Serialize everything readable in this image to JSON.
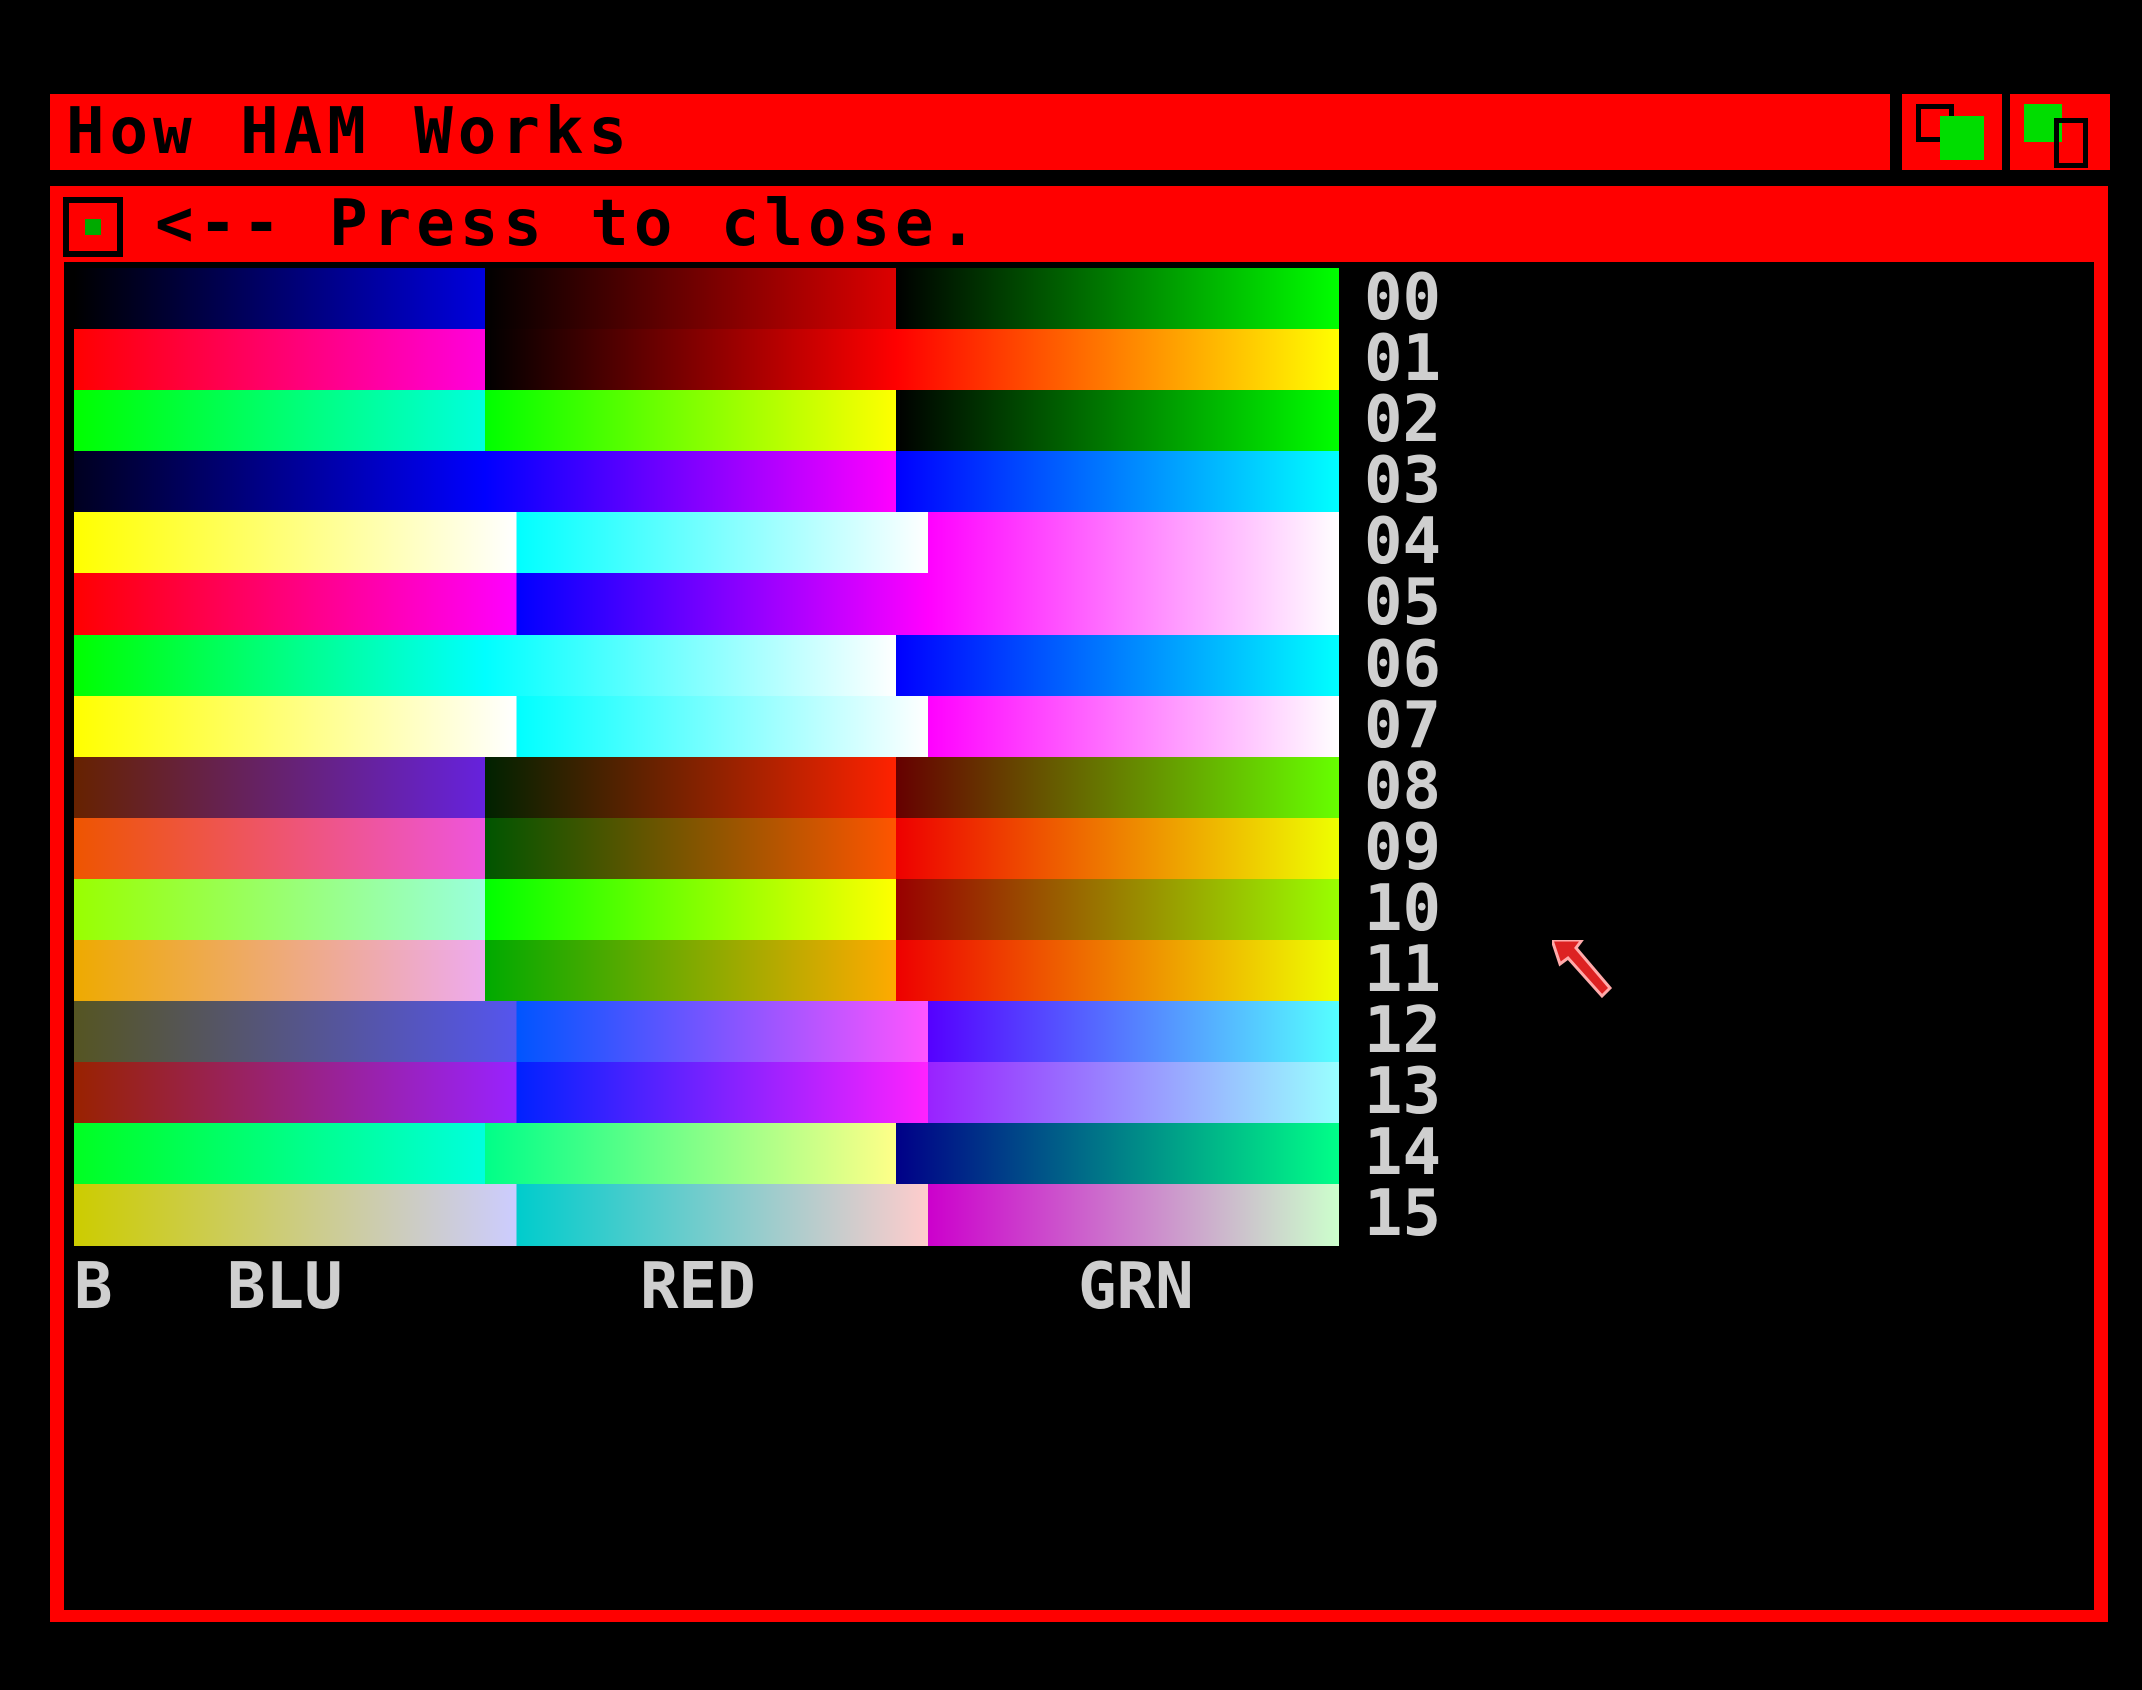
{
  "window": {
    "title": "How HAM Works",
    "close_hint": "<-- Press to close."
  },
  "legend": {
    "b": "B",
    "blu": "BLU",
    "red": "RED",
    "grn": "GRN"
  },
  "rows": [
    {
      "label": "00",
      "bands": [
        {
          "type": "grad",
          "from": "#000000",
          "to": "#0000dd",
          "w": 0.325
        },
        {
          "type": "grad",
          "from": "#000000",
          "to": "#dd0000",
          "w": 0.325
        },
        {
          "type": "grad",
          "from": "#000000",
          "to": "#00ff00",
          "w": 0.35
        }
      ]
    },
    {
      "label": "01",
      "bands": [
        {
          "type": "grad",
          "from": "#ff0000",
          "to": "#ff00dd",
          "w": 0.325
        },
        {
          "type": "grad",
          "from": "#000000",
          "to": "#ff0000",
          "w": 0.325
        },
        {
          "type": "grad",
          "from": "#ff0000",
          "to": "#ffff00",
          "w": 0.35
        }
      ]
    },
    {
      "label": "02",
      "bands": [
        {
          "type": "grad",
          "from": "#00ff00",
          "to": "#00ffdd",
          "w": 0.325
        },
        {
          "type": "grad",
          "from": "#00ff00",
          "to": "#ffff00",
          "w": 0.325
        },
        {
          "type": "grad",
          "from": "#000000",
          "to": "#00ff00",
          "w": 0.35
        }
      ]
    },
    {
      "label": "03",
      "bands": [
        {
          "type": "grad",
          "from": "#000020",
          "to": "#0000ff",
          "w": 0.325
        },
        {
          "type": "grad",
          "from": "#0000ff",
          "to": "#ff00ff",
          "w": 0.325
        },
        {
          "type": "grad",
          "from": "#0000ff",
          "to": "#00ffff",
          "w": 0.35
        }
      ]
    },
    {
      "label": "04",
      "bands": [
        {
          "type": "grad",
          "from": "#ffff00",
          "to": "#ffffff",
          "w": 0.35
        },
        {
          "type": "grad",
          "from": "#00ffff",
          "to": "#ffffff",
          "w": 0.325
        },
        {
          "type": "grad",
          "from": "#ff00ff",
          "to": "#ffffff",
          "w": 0.325
        }
      ]
    },
    {
      "label": "05",
      "bands": [
        {
          "type": "grad",
          "from": "#ff0000",
          "to": "#ff00ff",
          "w": 0.35
        },
        {
          "type": "grad",
          "from": "#0000ff",
          "to": "#ff00ff",
          "w": 0.325
        },
        {
          "type": "grad",
          "from": "#ff00ff",
          "to": "#ffffff",
          "w": 0.325
        }
      ]
    },
    {
      "label": "06",
      "bands": [
        {
          "type": "grad",
          "from": "#00ff00",
          "to": "#00ffff",
          "w": 0.325
        },
        {
          "type": "grad",
          "from": "#00ffff",
          "to": "#ffffff",
          "w": 0.325
        },
        {
          "type": "grad",
          "from": "#0000ff",
          "to": "#00ffff",
          "w": 0.35
        }
      ]
    },
    {
      "label": "07",
      "bands": [
        {
          "type": "grad",
          "from": "#ffff00",
          "to": "#ffffff",
          "w": 0.35
        },
        {
          "type": "grad",
          "from": "#00ffff",
          "to": "#ffffff",
          "w": 0.325
        },
        {
          "type": "grad",
          "from": "#ff00ff",
          "to": "#ffffff",
          "w": 0.325
        }
      ]
    },
    {
      "label": "08",
      "bands": [
        {
          "type": "grad",
          "from": "#662200",
          "to": "#6622dd",
          "w": 0.325
        },
        {
          "type": "grad",
          "from": "#002200",
          "to": "#ff2200",
          "w": 0.325
        },
        {
          "type": "grad",
          "from": "#660000",
          "to": "#66ff00",
          "w": 0.35
        }
      ]
    },
    {
      "label": "09",
      "bands": [
        {
          "type": "grad",
          "from": "#ee5500",
          "to": "#ee55dd",
          "w": 0.325
        },
        {
          "type": "grad",
          "from": "#005500",
          "to": "#ff5500",
          "w": 0.325
        },
        {
          "type": "grad",
          "from": "#ee0000",
          "to": "#eeff00",
          "w": 0.35
        }
      ]
    },
    {
      "label": "10",
      "bands": [
        {
          "type": "grad",
          "from": "#99ff00",
          "to": "#99ffdd",
          "w": 0.325
        },
        {
          "type": "grad",
          "from": "#00ff00",
          "to": "#ffff00",
          "w": 0.325
        },
        {
          "type": "grad",
          "from": "#990000",
          "to": "#99ff00",
          "w": 0.35
        }
      ]
    },
    {
      "label": "11",
      "bands": [
        {
          "type": "grad",
          "from": "#eeaa00",
          "to": "#eeaaee",
          "w": 0.325
        },
        {
          "type": "grad",
          "from": "#00aa00",
          "to": "#ffaa00",
          "w": 0.325
        },
        {
          "type": "grad",
          "from": "#ee0000",
          "to": "#eeff00",
          "w": 0.35
        }
      ]
    },
    {
      "label": "12",
      "bands": [
        {
          "type": "grad",
          "from": "#555522",
          "to": "#5555ee",
          "w": 0.35
        },
        {
          "type": "grad",
          "from": "#0055ff",
          "to": "#ff55ff",
          "w": 0.325
        },
        {
          "type": "grad",
          "from": "#5500ff",
          "to": "#55ffff",
          "w": 0.325
        }
      ]
    },
    {
      "label": "13",
      "bands": [
        {
          "type": "grad",
          "from": "#992200",
          "to": "#9922ff",
          "w": 0.35
        },
        {
          "type": "grad",
          "from": "#0022ff",
          "to": "#ff22ff",
          "w": 0.325
        },
        {
          "type": "grad",
          "from": "#9922ff",
          "to": "#99ffff",
          "w": 0.325
        }
      ]
    },
    {
      "label": "14",
      "bands": [
        {
          "type": "grad",
          "from": "#00ff22",
          "to": "#00ffdd",
          "w": 0.325
        },
        {
          "type": "grad",
          "from": "#00ff88",
          "to": "#ffff88",
          "w": 0.325
        },
        {
          "type": "grad",
          "from": "#000088",
          "to": "#00ff88",
          "w": 0.35
        }
      ]
    },
    {
      "label": "15",
      "bands": [
        {
          "type": "grad",
          "from": "#cccc00",
          "to": "#ccccff",
          "w": 0.35
        },
        {
          "type": "grad",
          "from": "#00cccc",
          "to": "#ffcccc",
          "w": 0.325
        },
        {
          "type": "grad",
          "from": "#cc00cc",
          "to": "#ccffcc",
          "w": 0.325
        }
      ]
    }
  ],
  "colors": {
    "frame": "#ff0000",
    "background": "#000000",
    "label_text": "#cfcfcf",
    "gadget_green": "#00dd00"
  }
}
